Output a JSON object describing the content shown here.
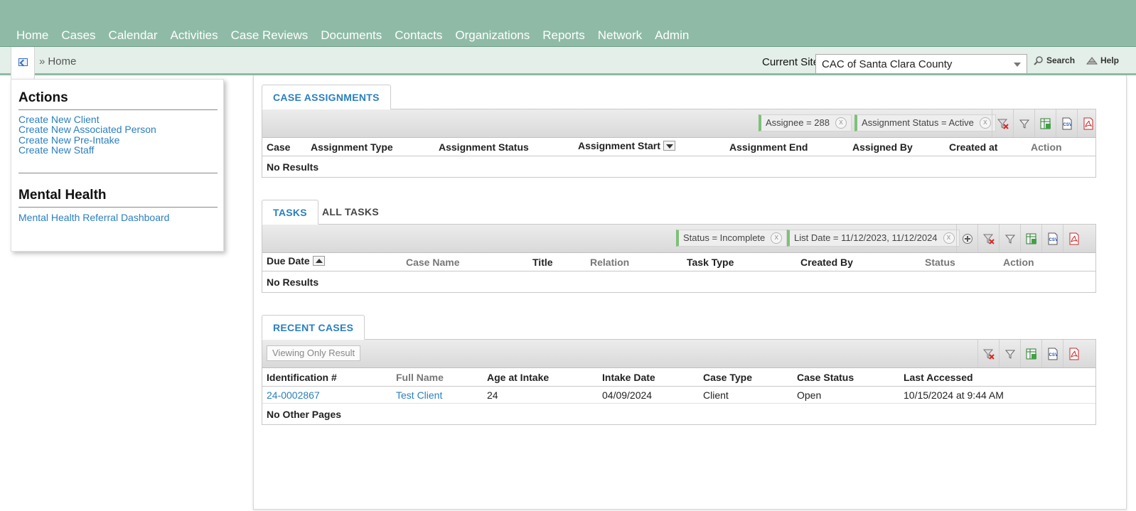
{
  "nav": {
    "items": [
      "Home",
      "Cases",
      "Calendar",
      "Activities",
      "Case Reviews",
      "Documents",
      "Contacts",
      "Organizations",
      "Reports",
      "Network",
      "Admin"
    ]
  },
  "breadcrumb": {
    "separator": "»",
    "current": "Home"
  },
  "site": {
    "label": "Current Site",
    "value": "CAC of Santa Clara County"
  },
  "search_label": "Search",
  "help_label": "Help",
  "sidebar": {
    "actions_title": "Actions",
    "actions": [
      "Create New Client",
      "Create New Associated Person",
      "Create New Pre-Intake",
      "Create New Staff"
    ],
    "mh_title": "Mental Health",
    "mh_links": [
      "Mental Health Referral Dashboard"
    ]
  },
  "case_assignments": {
    "tab": "CASE ASSIGNMENTS",
    "filters": [
      "Assignee = 288",
      "Assignment Status = Active"
    ],
    "columns": [
      "Case",
      "Assignment Type",
      "Assignment Status",
      "Assignment Start",
      "Assignment End",
      "Assigned By",
      "Created at",
      "Action"
    ],
    "empty": "No Results"
  },
  "tasks": {
    "tabs": [
      "TASKS",
      "ALL TASKS"
    ],
    "filters": [
      "Status = Incomplete",
      "List Date = 11/12/2023, 11/12/2024"
    ],
    "columns": [
      "Due Date",
      "Case Name",
      "Title",
      "Relation",
      "Task Type",
      "Created By",
      "Status",
      "Action"
    ],
    "empty": "No Results"
  },
  "recent_cases": {
    "tab": "RECENT CASES",
    "viewing": "Viewing Only Result",
    "columns": [
      "Identification #",
      "Full Name",
      "Age at Intake",
      "Intake Date",
      "Case Type",
      "Case Status",
      "Last Accessed"
    ],
    "rows": [
      {
        "id": "24-0002867",
        "name": "Test Client",
        "age": "24",
        "intake_date": "04/09/2024",
        "case_type": "Client",
        "status": "Open",
        "last_accessed": "10/15/2024 at 9:44 AM"
      }
    ],
    "footer": "No Other Pages"
  },
  "filter_clear_symbol": "x",
  "icons": [
    "grid-toggle-icon",
    "search-icon",
    "help-icon",
    "clear-filter-icon",
    "filter-icon",
    "excel-export-icon",
    "csv-export-icon",
    "pdf-export-icon",
    "add-filter-icon"
  ],
  "colors": {
    "nav_bg": "#8fbba6",
    "link": "#2a7fc1",
    "chip_accent": "#7ec07a"
  }
}
